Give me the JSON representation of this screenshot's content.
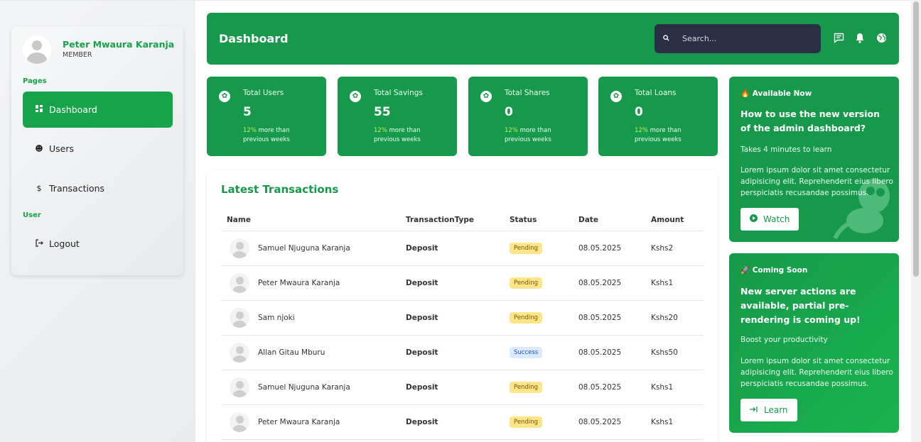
{
  "profile": {
    "name": "Peter Mwaura Karanja",
    "role": "MEMBER"
  },
  "sidebar": {
    "pages_label": "Pages",
    "user_label": "User",
    "items": [
      {
        "label": "Dashboard",
        "icon": "grid-icon"
      },
      {
        "label": "Users",
        "icon": "users-icon"
      },
      {
        "label": "Transactions",
        "icon": "dollar-icon"
      },
      {
        "label": "Logout",
        "icon": "logout-icon"
      }
    ]
  },
  "header": {
    "title": "Dashboard",
    "search_placeholder": "Search...",
    "icons": [
      "message-icon",
      "bell-icon",
      "globe-icon"
    ]
  },
  "stats": [
    {
      "label": "Total Users",
      "value": "5",
      "pct": "12%",
      "note": "more than previous weeks"
    },
    {
      "label": "Total Savings",
      "value": "55",
      "pct": "12%",
      "note": "more than previous weeks"
    },
    {
      "label": "Total Shares",
      "value": "0",
      "pct": "12%",
      "note": "more than previous weeks"
    },
    {
      "label": "Total Loans",
      "value": "0",
      "pct": "12%",
      "note": "more than previous weeks"
    }
  ],
  "transactions": {
    "title": "Latest Transactions",
    "columns": [
      "Name",
      "TransactionType",
      "Status",
      "Date",
      "Amount"
    ],
    "rows": [
      {
        "name": "Samuel Njuguna Karanja",
        "type": "Deposit",
        "status": "Pending",
        "date": "08.05.2025",
        "amount": "Kshs2"
      },
      {
        "name": "Peter Mwaura Karanja",
        "type": "Deposit",
        "status": "Pending",
        "date": "08.05.2025",
        "amount": "Kshs1"
      },
      {
        "name": "Sam njoki",
        "type": "Deposit",
        "status": "Pending",
        "date": "08.05.2025",
        "amount": "Kshs20"
      },
      {
        "name": "Allan Gitau Mburu",
        "type": "Deposit",
        "status": "Success",
        "date": "08.05.2025",
        "amount": "Kshs50"
      },
      {
        "name": "Samuel Njuguna Karanja",
        "type": "Deposit",
        "status": "Pending",
        "date": "08.05.2025",
        "amount": "Kshs1"
      },
      {
        "name": "Peter Mwaura Karanja",
        "type": "Deposit",
        "status": "Pending",
        "date": "08.05.2025",
        "amount": "Kshs1"
      }
    ]
  },
  "promos": [
    {
      "tag": "🔥 Available Now",
      "title": "How to use the new version of the admin dashboard?",
      "subtitle": "Takes 4 minutes to learn",
      "body": "Lorem ipsum dolor sit amet consectetur adipisicing elit. Reprehenderit eius libero perspiciatis recusandae possimus.",
      "button": "Watch",
      "button_icon": "play-icon"
    },
    {
      "tag": "🚀 Coming Soon",
      "title": "New server actions are available, partial pre-rendering is coming up!",
      "subtitle": "Boost your productivity",
      "body": "Lorem ipsum dolor sit amet consectetur adipisicing elit. Reprehenderit eius libero perspiciatis recusandae possimus.",
      "button": "Learn",
      "button_icon": "arrow-in-icon"
    }
  ],
  "colors": {
    "brand": "#16994a",
    "accent_dark": "#2b2f45",
    "pending": "#fde68a",
    "success": "#dbeafe",
    "pct": "#bef264"
  }
}
